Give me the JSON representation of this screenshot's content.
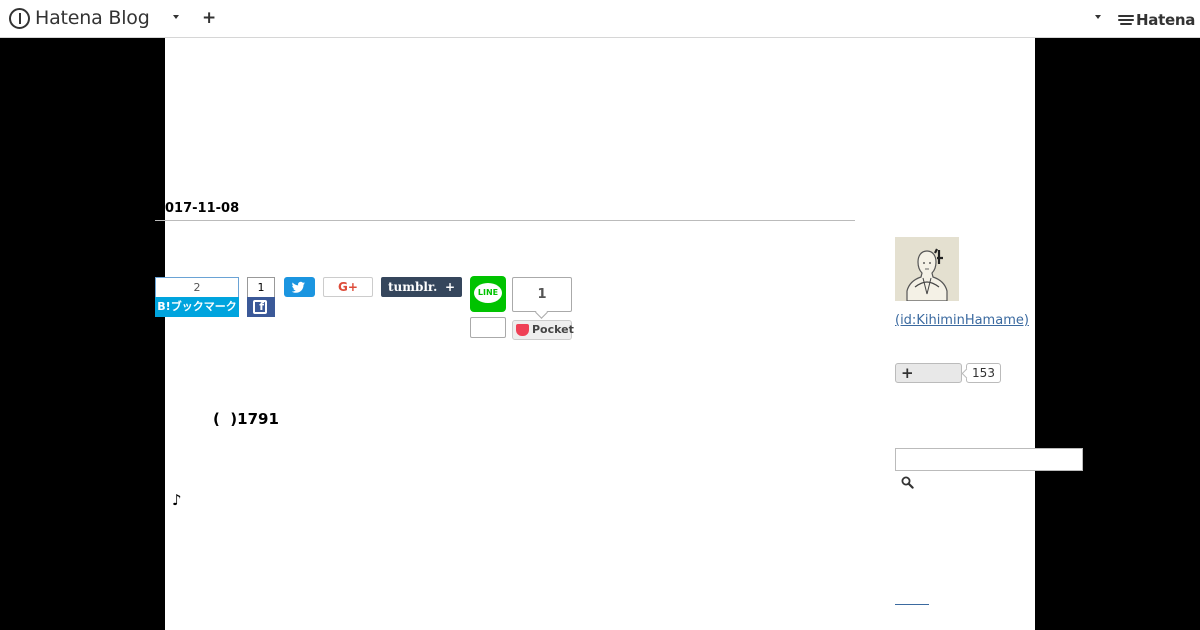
{
  "header": {
    "logo_text": "Hatena Blog",
    "plus_label": "+",
    "hatena_text": "Hatena"
  },
  "entry": {
    "date": "017-11-08",
    "content_line": "(  )1791",
    "note_glyph": "♪"
  },
  "share": {
    "hatebu_count": "2",
    "hatebu_label": "B!ブックマーク",
    "facebook_count": "1",
    "gplus_label": "G+",
    "tumblr_label": "tumblr.",
    "tumblr_plus": "+",
    "line_label": "LINE",
    "pocket_count": "1",
    "pocket_label": "Pocket"
  },
  "sidebar": {
    "profile_link": " (id:KihiminHamame)",
    "follow_plus": "+",
    "follow_count": "153",
    "search_placeholder": ""
  },
  "colors": {
    "background": "#000000",
    "content": "#ffffff",
    "hatebu_blue": "#00a4de",
    "facebook": "#3b5998",
    "twitter": "#1b95e0",
    "tumblr": "#35465c",
    "line": "#00c300",
    "pocket": "#ef4056",
    "link": "#3b6aa0"
  }
}
